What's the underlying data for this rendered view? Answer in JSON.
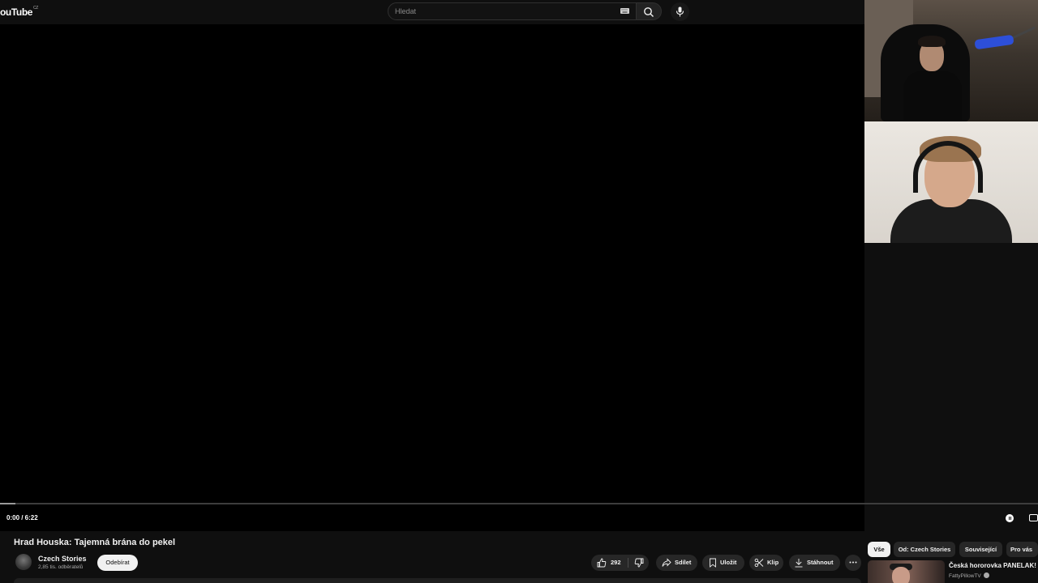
{
  "header": {
    "logo": "ouTube",
    "logo_region": "CZ",
    "search_placeholder": "Hledat"
  },
  "player": {
    "time": "0:00 / 6:22",
    "progress_fraction": 0.015
  },
  "video": {
    "title": "Hrad Houska: Tajemná brána do pekel",
    "channel_name": "Czech Stories",
    "subscribers": "2,85 tis. odběratelů",
    "subscribe_label": "Odebírat"
  },
  "actions": {
    "like_count": "292",
    "share_label": "Sdílet",
    "save_label": "Uložit",
    "clip_label": "Klip",
    "download_label": "Stáhnout"
  },
  "chips": [
    "Vše",
    "Od: Czech Stories",
    "Související",
    "Pro vás"
  ],
  "recommendation": {
    "title": "Česká hororovka PANELAK!",
    "channel": "FattyPillowTV"
  },
  "colors": {
    "background": "#0f0f0f",
    "player": "#000000",
    "pill": "#272727",
    "text": "#f1f1f1",
    "secondary_text": "#aaaaaa"
  }
}
